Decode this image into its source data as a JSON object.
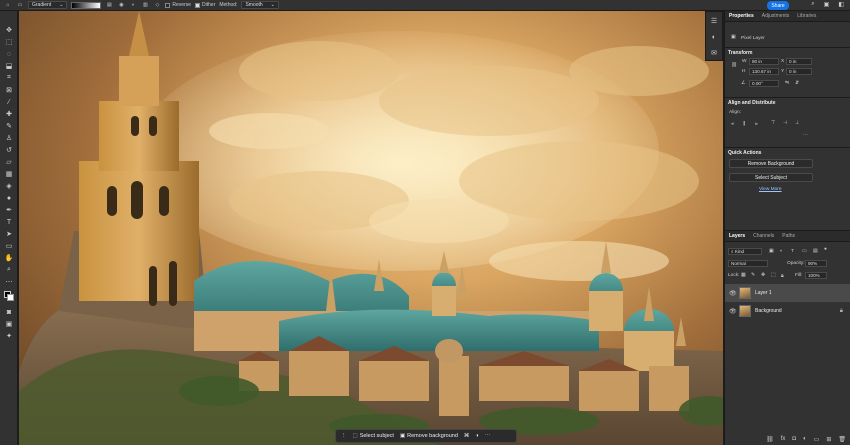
{
  "options_bar": {
    "tool_preset": "Gradient",
    "reverse_label": "Reverse",
    "reverse_checked": false,
    "dither_label": "Dither",
    "dither_checked": true,
    "method_label": "Method:",
    "method_value": "Smooth",
    "share_label": "Share"
  },
  "right_panel": {
    "tabs": [
      "Properties",
      "Adjustments",
      "Libraries"
    ],
    "layer_kind": "Pixel Layer",
    "transform": {
      "title": "Transform",
      "w_label": "W",
      "w_value": "80 in",
      "h_label": "H",
      "h_value": "130.67 in",
      "x_label": "X",
      "x_value": "0 in",
      "y_label": "Y",
      "y_value": "0 in",
      "angle_value": "0.00°"
    },
    "align": {
      "title": "Align and Distribute",
      "align_label": "Align:"
    },
    "quick_actions": {
      "title": "Quick Actions",
      "remove_bg": "Remove Background",
      "select_subject": "Select Subject",
      "view_more": "View More"
    },
    "layers": {
      "tabs": [
        "Layers",
        "Channels",
        "Paths"
      ],
      "kind_label": "Kind",
      "blend_mode": "Normal",
      "opacity_label": "Opacity:",
      "opacity_value": "90%",
      "lock_label": "Lock:",
      "fill_label": "Fill:",
      "fill_value": "100%",
      "items": [
        {
          "name": "Layer 1"
        },
        {
          "name": "Background"
        }
      ]
    }
  },
  "taskbar": {
    "select_subject": "Select subject",
    "remove_background": "Remove background"
  }
}
